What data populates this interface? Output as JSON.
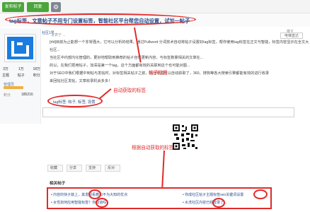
{
  "toolbar": {
    "post_label": "发布帖子",
    "reply_label": "回复"
  },
  "title": "tag标签，文章帖子不用专门设置标签，智能社区平台帮您自动设置，试加一帖子",
  "annotations": {
    "tag_note": "帖子标题",
    "auto_tag": "自动获取的标签",
    "auto_related": "根据自动获取的标签..."
  },
  "post": {
    "username": "社区1号",
    "floor_label": "楼主",
    "floor_btn": "电梯直达",
    "time": "发表于 ...",
    "body_lines": [
      "[rfd]目前为止能想一个非常强大，它可以分析的结果。通过Pullword 分词技术自动将帖子设置好tag标签，帮你使用tag标签在正文与智能，标签内容显示在全文大社区...",
      "当社区中内部内化管理的，更好地帮助到推荐的帖子自然更新内容，与标签数量相关的文章在...",
      "的以，在我们把用帖子，加深是第一个tag，这个方面都有效的关联到这个也可能对图...",
      "对于SEO中我们根据中到帖与发帖时，对标签相关帖子之前，现在标签可以自动获取了，360、搜狗等各大搜索引擎都能有效的进行收录",
      "来回帖社区发帖，文章收录机会多多！"
    ],
    "tags_line": "tag标签: 帖子, 标签, 设置",
    "stats": {
      "topics": "3万",
      "replies": "1万",
      "points": "18万",
      "topics_label": "主题",
      "replies_label": "帖子",
      "points_label": "积分"
    },
    "rank": "管理员",
    "points_label": "积分",
    "points_value": "185216"
  },
  "actions": {
    "fav": "收藏",
    "share": "分享",
    "like": "支持",
    "dislike": "反对"
  },
  "related": {
    "header": "相关帖子",
    "items": [
      "• 内容的快子敲上，其发现看着出不为大知的优点",
      "• 女性如何应用智能标签？你知道吗？",
      "• 你成社区帖子主题标签seo关键词设置",
      "• 水洗社区内容已经收录了..."
    ]
  },
  "colors": {
    "accent_green": "#4aa53a",
    "annotation_red": "#e12a2a",
    "link_blue": "#2a4f8f",
    "avatar_blue": "#1a7ce0"
  },
  "icons": {
    "settings": "gear-icon"
  }
}
